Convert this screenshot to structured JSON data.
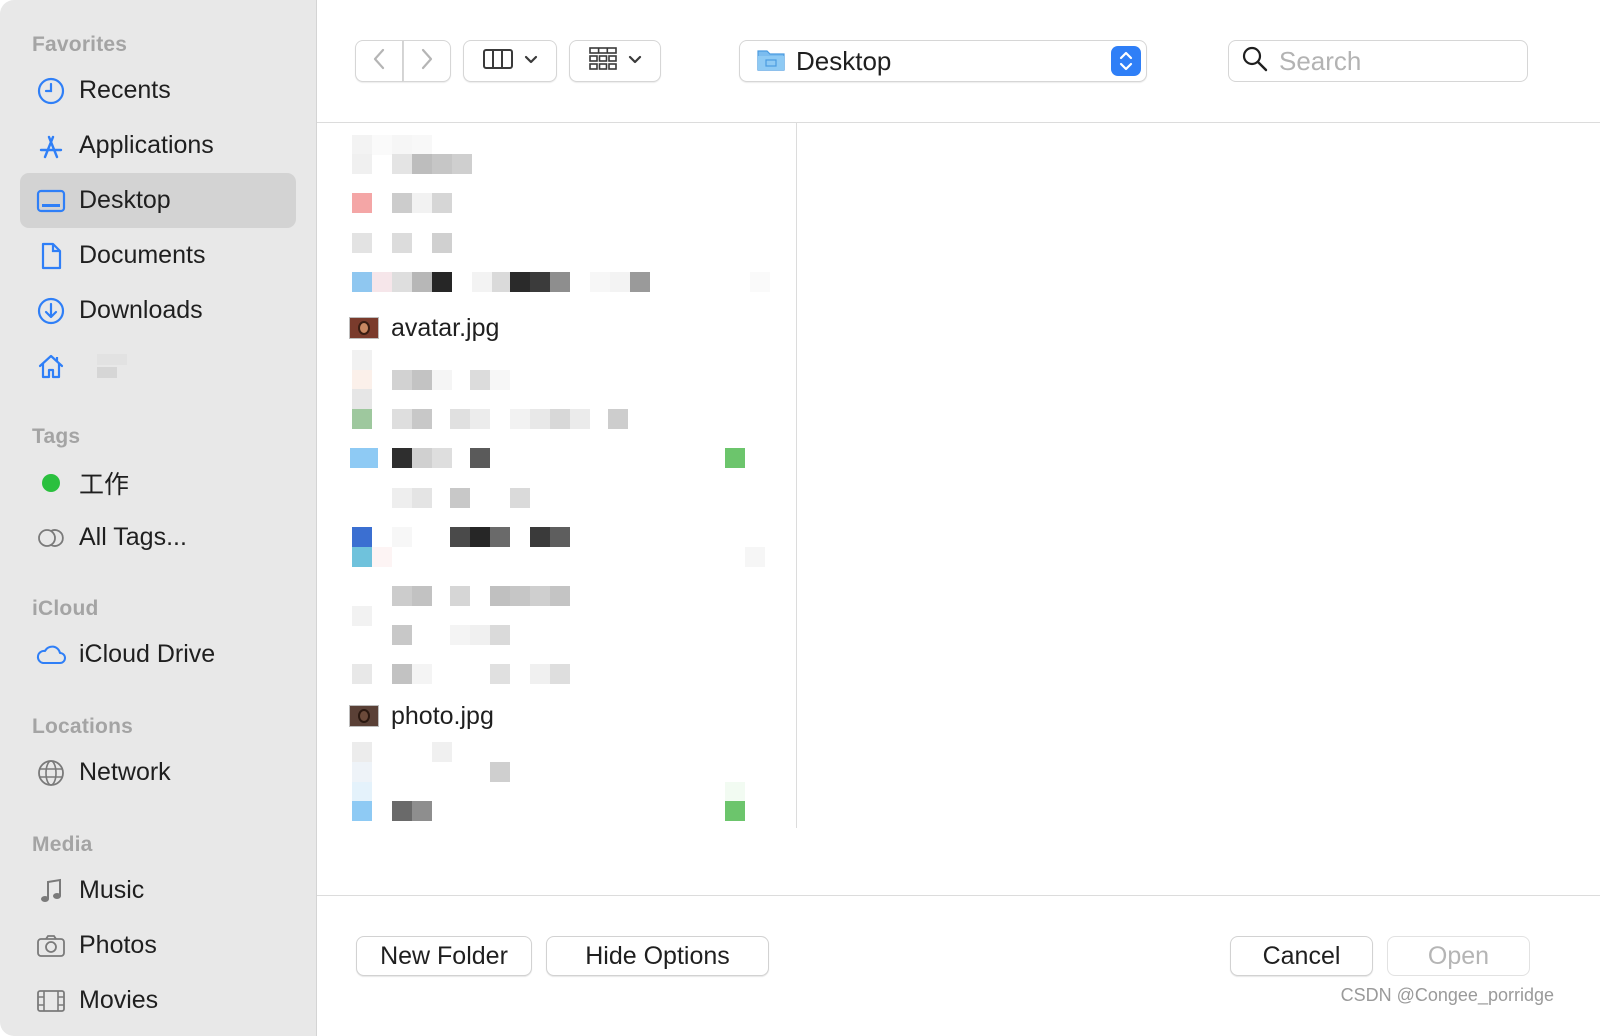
{
  "sidebar": {
    "favorites_header": "Favorites",
    "favorites": [
      {
        "label": "Recents",
        "icon": "clock-icon"
      },
      {
        "label": "Applications",
        "icon": "applications-icon"
      },
      {
        "label": "Desktop",
        "icon": "desktop-icon",
        "selected": true
      },
      {
        "label": "Documents",
        "icon": "document-icon"
      },
      {
        "label": "Downloads",
        "icon": "download-icon"
      },
      {
        "label": "",
        "icon": "home-icon"
      }
    ],
    "tags_header": "Tags",
    "tags": [
      {
        "label": "工作",
        "color": "#2ac03e"
      },
      {
        "label": "All Tags..."
      }
    ],
    "icloud_header": "iCloud",
    "icloud": [
      {
        "label": "iCloud Drive",
        "icon": "cloud-icon"
      }
    ],
    "locations_header": "Locations",
    "locations": [
      {
        "label": "Network",
        "icon": "globe-icon"
      }
    ],
    "media_header": "Media",
    "media": [
      {
        "label": "Music",
        "icon": "music-note-icon"
      },
      {
        "label": "Photos",
        "icon": "camera-icon"
      },
      {
        "label": "Movies",
        "icon": "film-icon"
      }
    ]
  },
  "toolbar": {
    "location": "Desktop",
    "search_placeholder": "Search",
    "accent": "#2f7ff7"
  },
  "files": [
    {
      "name": "avatar.jpg",
      "type": "image"
    },
    {
      "name": "photo.jpg",
      "type": "image"
    }
  ],
  "buttons": {
    "new_folder": "New Folder",
    "hide_options": "Hide Options",
    "cancel": "Cancel",
    "open": "Open"
  },
  "watermark": "CSDN @Congee_porridge"
}
